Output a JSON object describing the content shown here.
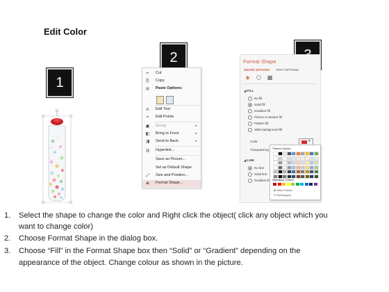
{
  "title": "Edit Color",
  "badges": [
    "1",
    "2",
    "3"
  ],
  "context_menu": {
    "items": [
      {
        "label": "Cut",
        "icon": "scissors-icon",
        "glyph": "✂",
        "arrow": ""
      },
      {
        "label": "Copy",
        "icon": "copy-icon",
        "glyph": "⎘",
        "arrow": ""
      },
      {
        "label": "Paste Options:",
        "icon": "clipboard-icon",
        "glyph": "📋",
        "arrow": ""
      },
      {
        "label": "Edit Text",
        "icon": "edit-text-icon",
        "glyph": "A",
        "arrow": ""
      },
      {
        "label": "Edit Points",
        "icon": "edit-points-icon",
        "glyph": "⌖",
        "arrow": ""
      },
      {
        "label": "Group",
        "icon": "group-icon",
        "glyph": "▣",
        "arrow": "▸"
      },
      {
        "label": "Bring to Front",
        "icon": "bring-front-icon",
        "glyph": "◧",
        "arrow": "▸"
      },
      {
        "label": "Send to Back",
        "icon": "send-back-icon",
        "glyph": "◨",
        "arrow": "▸"
      },
      {
        "label": "Hyperlink...",
        "icon": "hyperlink-icon",
        "glyph": "🔗",
        "arrow": ""
      },
      {
        "label": "Save as Picture...",
        "icon": "",
        "glyph": "",
        "arrow": ""
      },
      {
        "label": "Set as Default Shape",
        "icon": "",
        "glyph": "",
        "arrow": ""
      },
      {
        "label": "Size and Position...",
        "icon": "size-position-icon",
        "glyph": "⤢",
        "arrow": ""
      },
      {
        "label": "Format Shape...",
        "icon": "format-shape-icon",
        "glyph": "◈",
        "arrow": ""
      }
    ]
  },
  "format_shape": {
    "title": "Format Shape",
    "tabs": [
      "SHAPE OPTIONS",
      "TEXT OPTIONS"
    ],
    "fill_section": "FILL",
    "fill_options": [
      "No fill",
      "Solid fill",
      "Gradient fill",
      "Picture or texture fill",
      "Pattern fill",
      "Slide background fill"
    ],
    "color_label": "Color",
    "transparency_label": "Transparency",
    "line_section": "LINE",
    "line_options": [
      "No line",
      "Solid line",
      "Gradient line"
    ],
    "accent_color": "#d15a3c"
  },
  "palette": {
    "theme_header": "Theme Colors",
    "standard_header": "Standard Colors",
    "more_colors": "More Colors...",
    "eyedropper": "Eyedropper",
    "theme_colors": [
      "#ffffff",
      "#000000",
      "#e7e6e6",
      "#44546a",
      "#5b9bd5",
      "#ed7d31",
      "#a5a5a5",
      "#ffc000",
      "#4472c4",
      "#70ad47"
    ],
    "standard_colors": [
      "#c00000",
      "#ff0000",
      "#ffc000",
      "#ffff00",
      "#92d050",
      "#00b050",
      "#00b0f0",
      "#0070c0",
      "#002060",
      "#7030a0"
    ]
  },
  "instructions": [
    {
      "n": "1.",
      "text": "Select the shape to change the color and Right click the object( click any object which you"
    },
    {
      "n": "",
      "text": "want to change color)"
    },
    {
      "n": "2.",
      "text": "Choose Format Shape in the dialog box."
    },
    {
      "n": "3.",
      "text": "Choose “Fill” in the Format Shape box then “Solid” or “Gradient” depending on the"
    },
    {
      "n": "",
      "text": "appearance of the object. Change colour as shown in the picture."
    }
  ]
}
